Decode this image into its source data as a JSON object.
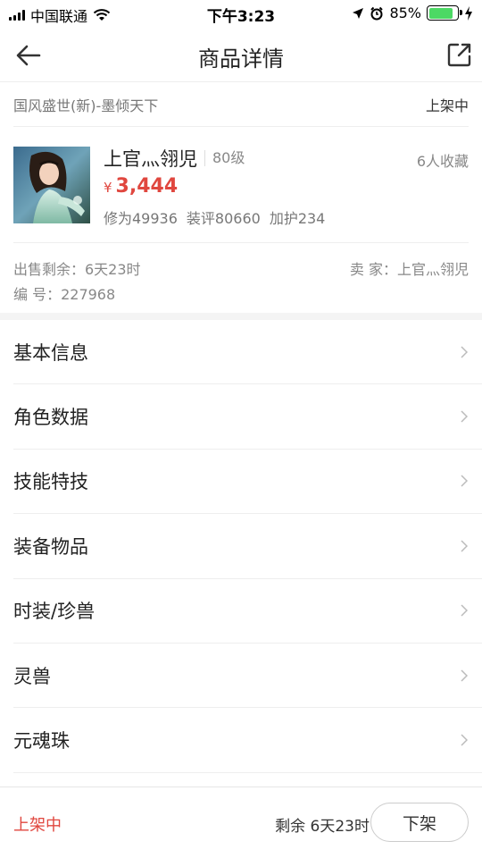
{
  "status_bar": {
    "carrier": "中国联通",
    "time": "下午3:23",
    "battery_percent": "85%",
    "battery_level": 0.85,
    "icons": [
      "signal-icon",
      "wifi-icon",
      "location-icon",
      "alarm-icon",
      "battery-icon",
      "charging-icon"
    ]
  },
  "nav": {
    "title": "商品详情",
    "back_icon": "back-arrow-icon",
    "share_icon": "share-icon"
  },
  "server": {
    "name": "国风盛世(新)-墨倾天下",
    "status": "上架中"
  },
  "product": {
    "name": "上官灬翎児",
    "level": "80级",
    "favorites": "6人收藏",
    "currency_symbol": "¥",
    "price": "3,444",
    "stats": [
      "修为49936",
      "装评80660",
      "加护234"
    ]
  },
  "meta": {
    "sale_remaining": "出售剩余：6天23时",
    "seller": "卖 家：上官灬翎児",
    "serial": "编 号：227968"
  },
  "menu": [
    {
      "label": "基本信息"
    },
    {
      "label": "角色数据"
    },
    {
      "label": "技能特技"
    },
    {
      "label": "装备物品"
    },
    {
      "label": "时装/珍兽"
    },
    {
      "label": "灵兽"
    },
    {
      "label": "元魂珠"
    }
  ],
  "bottom": {
    "status": "上架中",
    "remaining": "剩余 6天23时",
    "button": "下架"
  },
  "colors": {
    "accent_red": "#e0473f",
    "battery_green": "#4cd964"
  }
}
